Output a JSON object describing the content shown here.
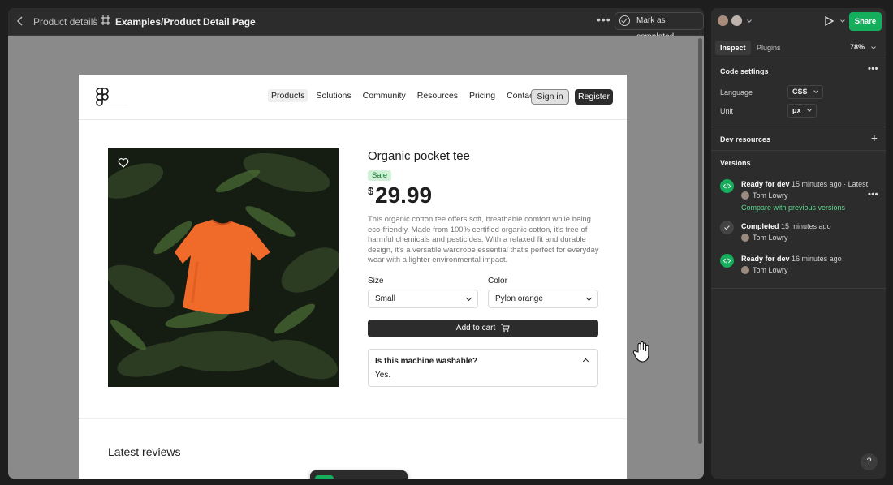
{
  "topbar": {
    "breadcrumb": "Product details",
    "separator": "/",
    "file_title": "Examples/Product Detail Page",
    "more": "•••",
    "mark_completed": "Mark as completed"
  },
  "site": {
    "nav": [
      "Products",
      "Solutions",
      "Community",
      "Resources",
      "Pricing",
      "Contact"
    ],
    "sign_in": "Sign in",
    "register": "Register"
  },
  "product": {
    "title": "Organic pocket tee",
    "badge": "Sale",
    "currency": "$",
    "price": "29.99",
    "description": "This organic cotton tee offers soft, breathable comfort while being eco-friendly. Made from 100% certified organic cotton, it's free of harmful chemicals and pesticides. With a relaxed fit and durable design, it's a versatile wardrobe essential that's perfect for everyday wear with a lighter environmental impact.",
    "size_label": "Size",
    "size_value": "Small",
    "color_label": "Color",
    "color_value": "Pylon orange",
    "cart_label": "Add to cart",
    "faq_question": "Is this machine washable?",
    "faq_answer": "Yes.",
    "reviews_heading": "Latest reviews"
  },
  "panel": {
    "share": "Share",
    "tabs": [
      "Inspect",
      "Plugins"
    ],
    "zoom": "78%",
    "code_settings": "Code settings",
    "language_label": "Language",
    "language_value": "CSS",
    "unit_label": "Unit",
    "unit_value": "px",
    "dev_resources": "Dev resources",
    "versions_title": "Versions",
    "versions": [
      {
        "status": "Ready for dev",
        "time": "15 minutes ago",
        "tag": "· Latest",
        "user": "Tom Lowry",
        "link": "Compare with previous versions"
      },
      {
        "status": "Completed",
        "time": "15 minutes ago",
        "user": "Tom Lowry"
      },
      {
        "status": "Ready for dev",
        "time": "16 minutes ago",
        "user": "Tom Lowry"
      }
    ],
    "help": "?"
  },
  "colors": {
    "accent_green": "#14ae5c",
    "tee_orange": "#f06a2a",
    "dark_ui": "#2c2c2c"
  }
}
